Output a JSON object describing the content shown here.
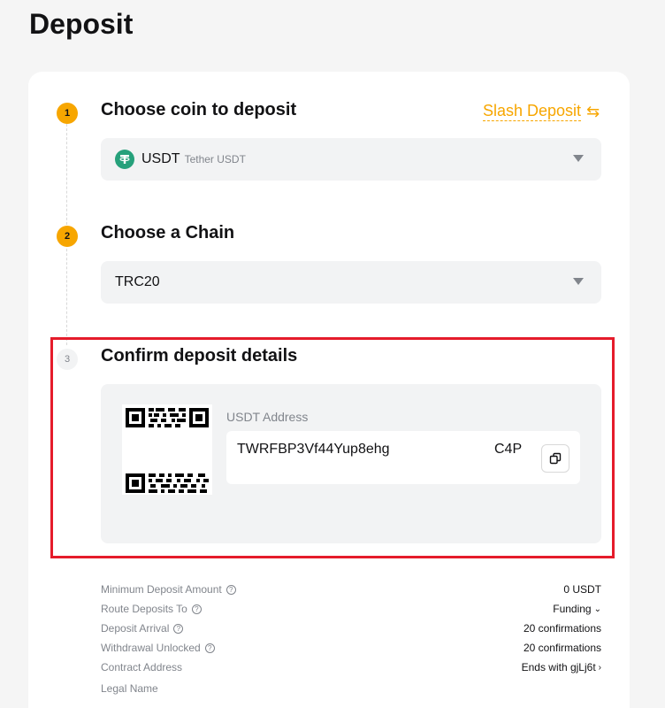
{
  "page": {
    "title": "Deposit"
  },
  "steps": [
    {
      "number": "1",
      "title": "Choose coin to deposit"
    },
    {
      "number": "2",
      "title": "Choose a Chain"
    },
    {
      "number": "3",
      "title": "Confirm deposit details"
    }
  ],
  "slash_deposit": {
    "label": "Slash Deposit",
    "icon": "swap-arrows-icon"
  },
  "coin_select": {
    "symbol": "USDT",
    "name": "Tether USDT",
    "icon_color": "#26a17b"
  },
  "chain_select": {
    "value": "TRC20"
  },
  "deposit": {
    "address_label": "USDT Address",
    "address_part1": "TWRFBP3Vf44Yup8ehg",
    "address_part2": "C4P"
  },
  "details": [
    {
      "label": "Minimum Deposit Amount",
      "value": "0 USDT",
      "help": true
    },
    {
      "label": "Route Deposits To",
      "value": "Funding",
      "help": true,
      "dropdown": true
    },
    {
      "label": "Deposit Arrival",
      "value": "20 confirmations",
      "help": true
    },
    {
      "label": "Withdrawal Unlocked",
      "value": "20 confirmations",
      "help": true
    },
    {
      "label": "Contract Address",
      "value": "Ends with gjLj6t",
      "help": false,
      "link": true
    },
    {
      "label": "Legal Name",
      "value": "",
      "help": false
    }
  ],
  "colors": {
    "accent": "#f7a600",
    "highlight": "#e51c2b",
    "panel": "#f2f3f4"
  }
}
